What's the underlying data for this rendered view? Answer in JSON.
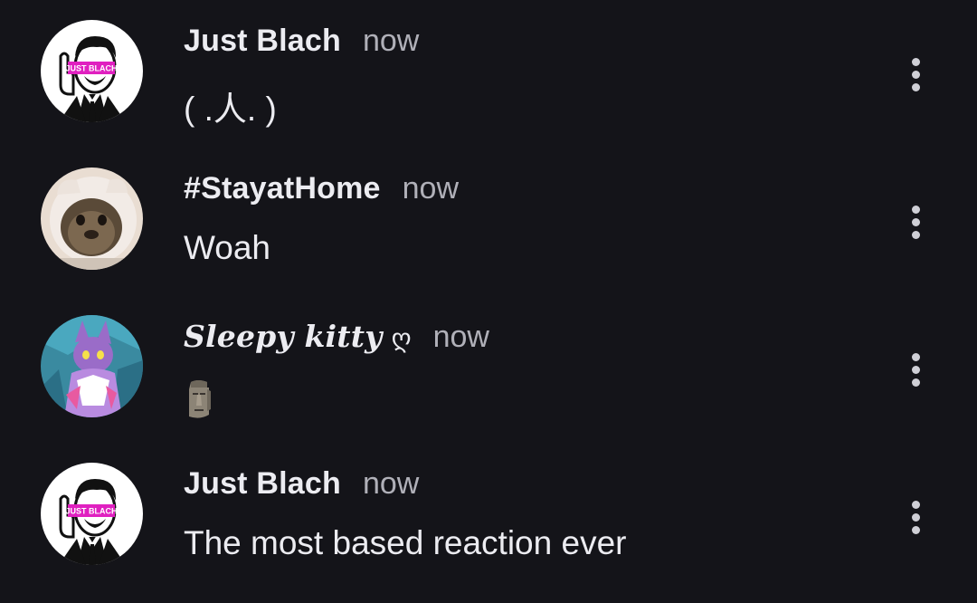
{
  "comments": [
    {
      "author": "Just Blach",
      "avatar_icon": "suited-man-avatar-icon",
      "avatar_badge": "JUST BLACH",
      "time": "now",
      "text": "( .人. )",
      "menu_icon": "more-vertical-icon"
    },
    {
      "author": "#StayatHome",
      "avatar_icon": "otter-in-hood-avatar-icon",
      "time": "now",
      "text": "Woah",
      "menu_icon": "more-vertical-icon"
    },
    {
      "author": "Sleepy kitty",
      "author_suffix": "ღ",
      "avatar_icon": "purple-cat-character-avatar-icon",
      "time": "now",
      "text_emoji": "moai-emoji",
      "menu_icon": "more-vertical-icon"
    },
    {
      "author": "Just Blach",
      "avatar_icon": "suited-man-avatar-icon",
      "avatar_badge": "JUST BLACH",
      "time": "now",
      "text": "The most based reaction ever",
      "menu_icon": "more-vertical-icon"
    }
  ],
  "colors": {
    "background": "#141419",
    "text_primary": "#ececf1",
    "text_secondary": "#b0b0b8",
    "badge": "#e020c0"
  }
}
